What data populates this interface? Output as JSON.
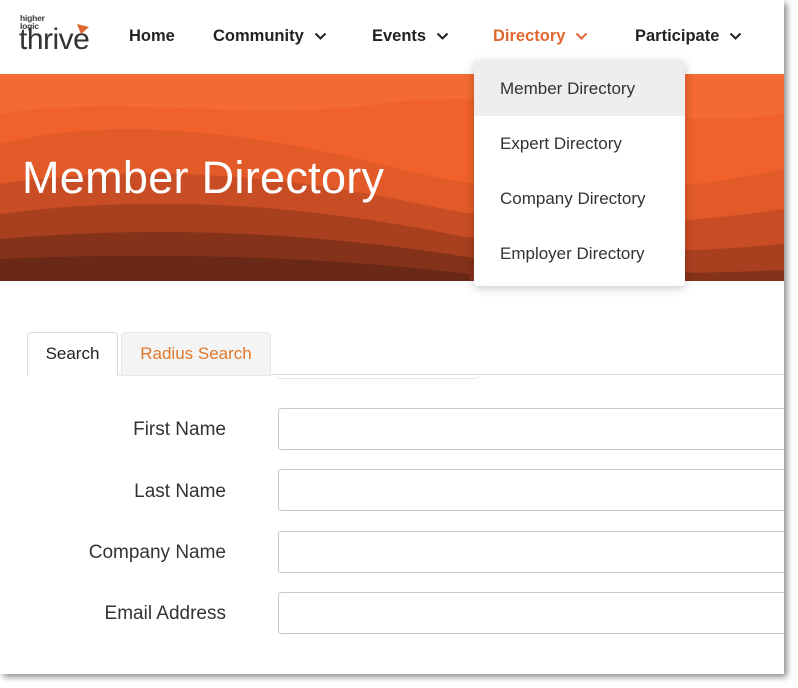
{
  "logo": {
    "tagline_1": "higher",
    "tagline_2": "logic",
    "wordmark": "thrive",
    "accent_color": "#e0672f"
  },
  "nav": {
    "items": [
      {
        "label": "Home",
        "has_dropdown": false
      },
      {
        "label": "Community",
        "has_dropdown": true
      },
      {
        "label": "Events",
        "has_dropdown": true
      },
      {
        "label": "Directory",
        "has_dropdown": true,
        "active": true
      },
      {
        "label": "Participate",
        "has_dropdown": true
      }
    ]
  },
  "dropdown": {
    "items": [
      {
        "label": "Member Directory",
        "highlighted": true
      },
      {
        "label": "Expert Directory"
      },
      {
        "label": "Company Directory"
      },
      {
        "label": "Employer Directory"
      }
    ]
  },
  "hero": {
    "title": "Member Directory",
    "colors": [
      "#f0612c",
      "#e25a28",
      "#c94d24",
      "#a8401f",
      "#85321a",
      "#6a2816"
    ]
  },
  "tabs": [
    {
      "label": "Search",
      "selected": true
    },
    {
      "label": "Radius Search",
      "selected": false
    }
  ],
  "form": {
    "fields": [
      {
        "label": "First Name",
        "value": "",
        "placeholder": ""
      },
      {
        "label": "Last Name",
        "value": "",
        "placeholder": ""
      },
      {
        "label": "Company Name",
        "value": "",
        "placeholder": ""
      },
      {
        "label": "Email Address",
        "value": "",
        "placeholder": ""
      }
    ]
  }
}
